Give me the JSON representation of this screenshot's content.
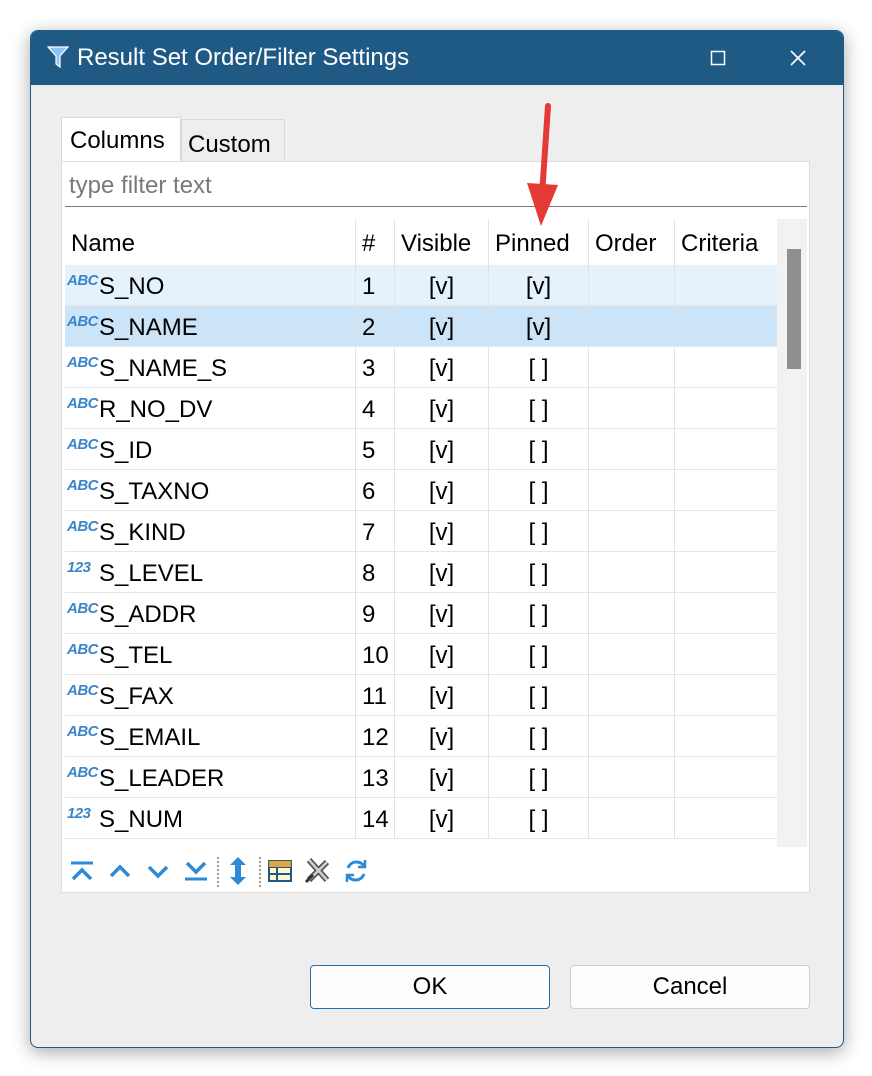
{
  "window": {
    "title": "Result Set Order/Filter Settings",
    "icons": {
      "app": "filter-funnel-icon",
      "maximize": "maximize-icon",
      "close": "close-icon"
    },
    "accent_color": "#1f5a85"
  },
  "tabs": [
    {
      "label": "Columns",
      "selected": true
    },
    {
      "label": "Custom",
      "selected": false
    }
  ],
  "filter": {
    "placeholder": "type filter text",
    "value": ""
  },
  "table": {
    "headers": {
      "name": "Name",
      "num": "#",
      "visible": "Visible",
      "pinned": "Pinned",
      "order": "Order",
      "criteria": "Criteria"
    },
    "rows": [
      {
        "type": "ABC",
        "name": "S_NO",
        "num": "1",
        "visible": "[v]",
        "pinned": "[v]",
        "order": "",
        "criteria": "",
        "state": "hover"
      },
      {
        "type": "ABC",
        "name": "S_NAME",
        "num": "2",
        "visible": "[v]",
        "pinned": "[v]",
        "order": "",
        "criteria": "",
        "state": "selected"
      },
      {
        "type": "ABC",
        "name": "S_NAME_S",
        "num": "3",
        "visible": "[v]",
        "pinned": "[ ]",
        "order": "",
        "criteria": ""
      },
      {
        "type": "ABC",
        "name": "R_NO_DV",
        "num": "4",
        "visible": "[v]",
        "pinned": "[ ]",
        "order": "",
        "criteria": ""
      },
      {
        "type": "ABC",
        "name": "S_ID",
        "num": "5",
        "visible": "[v]",
        "pinned": "[ ]",
        "order": "",
        "criteria": ""
      },
      {
        "type": "ABC",
        "name": "S_TAXNO",
        "num": "6",
        "visible": "[v]",
        "pinned": "[ ]",
        "order": "",
        "criteria": ""
      },
      {
        "type": "ABC",
        "name": "S_KIND",
        "num": "7",
        "visible": "[v]",
        "pinned": "[ ]",
        "order": "",
        "criteria": ""
      },
      {
        "type": "123",
        "name": "S_LEVEL",
        "num": "8",
        "visible": "[v]",
        "pinned": "[ ]",
        "order": "",
        "criteria": ""
      },
      {
        "type": "ABC",
        "name": "S_ADDR",
        "num": "9",
        "visible": "[v]",
        "pinned": "[ ]",
        "order": "",
        "criteria": ""
      },
      {
        "type": "ABC",
        "name": "S_TEL",
        "num": "10",
        "visible": "[v]",
        "pinned": "[ ]",
        "order": "",
        "criteria": ""
      },
      {
        "type": "ABC",
        "name": "S_FAX",
        "num": "11",
        "visible": "[v]",
        "pinned": "[ ]",
        "order": "",
        "criteria": ""
      },
      {
        "type": "ABC",
        "name": "S_EMAIL",
        "num": "12",
        "visible": "[v]",
        "pinned": "[ ]",
        "order": "",
        "criteria": ""
      },
      {
        "type": "ABC",
        "name": "S_LEADER",
        "num": "13",
        "visible": "[v]",
        "pinned": "[ ]",
        "order": "",
        "criteria": ""
      },
      {
        "type": "123",
        "name": "S_NUM",
        "num": "14",
        "visible": "[v]",
        "pinned": "[ ]",
        "order": "",
        "criteria": ""
      }
    ]
  },
  "toolbar": {
    "icons": [
      "move-to-top-icon",
      "move-up-icon",
      "move-down-icon",
      "move-to-bottom-icon",
      "auto-size-icon",
      "table-config-icon",
      "reset-icon",
      "refresh-icon"
    ]
  },
  "buttons": {
    "ok": "OK",
    "cancel": "Cancel"
  },
  "annotation": {
    "icon": "red-arrow-icon",
    "color": "#e53935"
  }
}
